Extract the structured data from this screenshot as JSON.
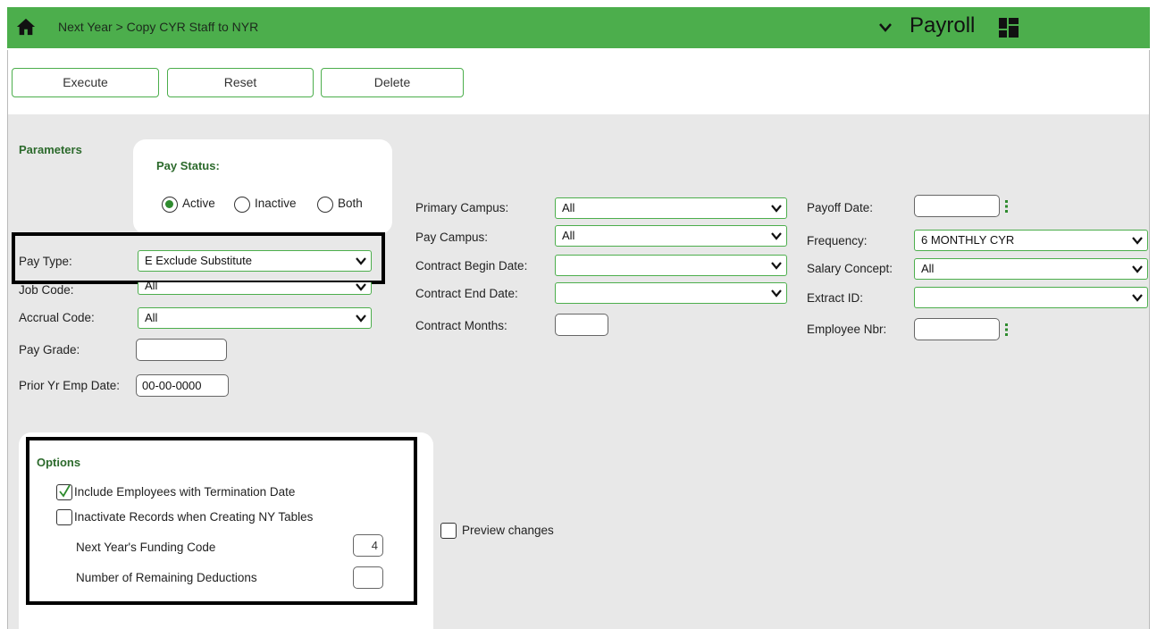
{
  "header": {
    "breadcrumb": "Next Year > Copy CYR Staff to NYR",
    "app_title": "Payroll"
  },
  "toolbar": {
    "execute_label": "Execute",
    "reset_label": "Reset",
    "delete_label": "Delete"
  },
  "parameters": {
    "title": "Parameters",
    "pay_status": {
      "title": "Pay Status:",
      "options": [
        "Active",
        "Inactive",
        "Both"
      ],
      "selected": "Active"
    },
    "pay_type": {
      "label": "Pay Type:",
      "value": "E Exclude Substitute"
    },
    "job_code": {
      "label": "Job Code:",
      "value": "All"
    },
    "accrual_code": {
      "label": "Accrual Code:",
      "value": "All"
    },
    "pay_grade": {
      "label": "Pay Grade:",
      "value": ""
    },
    "prior_yr_emp_date": {
      "label": "Prior Yr Emp Date:",
      "value": "00-00-0000"
    },
    "primary_campus": {
      "label": "Primary Campus:",
      "value": "All"
    },
    "pay_campus": {
      "label": "Pay Campus:",
      "value": "All"
    },
    "contract_begin_date": {
      "label": "Contract Begin Date:",
      "value": ""
    },
    "contract_end_date": {
      "label": "Contract End Date:",
      "value": ""
    },
    "contract_months": {
      "label": "Contract Months:",
      "value": ""
    },
    "payoff_date": {
      "label": "Payoff Date:",
      "value": ""
    },
    "frequency": {
      "label": "Frequency:",
      "value": "6 MONTHLY CYR"
    },
    "salary_concept": {
      "label": "Salary Concept:",
      "value": "All"
    },
    "extract_id": {
      "label": "Extract ID:",
      "value": ""
    },
    "employee_nbr": {
      "label": "Employee Nbr:",
      "value": ""
    }
  },
  "options": {
    "title": "Options",
    "include_terminated": {
      "label": "Include Employees with Termination Date",
      "checked": true
    },
    "inactivate_records": {
      "label": "Inactivate Records when Creating NY Tables",
      "checked": false
    },
    "funding_code": {
      "label": "Next Year's Funding Code",
      "value": "4"
    },
    "remaining_deductions": {
      "label": "Number of Remaining Deductions",
      "value": ""
    }
  },
  "preview": {
    "label": "Preview changes",
    "checked": false
  },
  "colors": {
    "header_green": "#4cae4c",
    "accent_green": "#2e8b2e",
    "content_gray": "#e8e8e8"
  },
  "icons": [
    "home-icon",
    "chevron-down-icon",
    "grid-icon",
    "caret-down-icon",
    "dots-icon",
    "check-icon"
  ]
}
